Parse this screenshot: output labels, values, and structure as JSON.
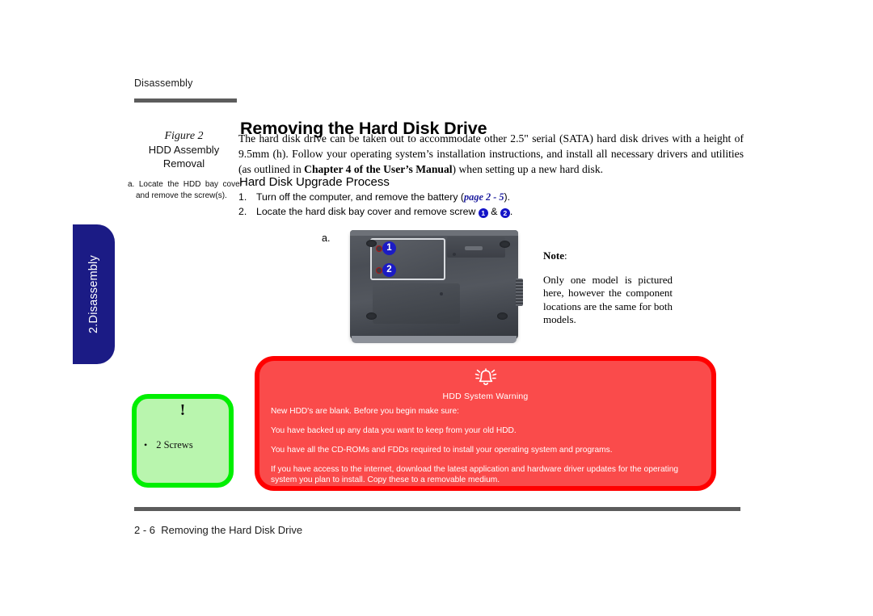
{
  "header": {
    "running_head": "Disassembly"
  },
  "chapter_tab": {
    "label": "2.Disassembly",
    "color": "#1b1b85"
  },
  "figure_caption": {
    "number": "Figure 2",
    "title_line1": "HDD Assembly",
    "title_line2": "Removal"
  },
  "margin_note": {
    "text": "a. Locate the HDD bay cover and remove the screw(s)."
  },
  "main": {
    "title": "Removing the Hard Disk Drive",
    "intro_part1": "The hard disk drive can be taken out to accommodate other 2.5\" serial (SATA) hard disk drives with a height of 9.5mm (h). Follow your operating system’s installation instructions, and install all necessary drivers and utilities (as outlined in ",
    "intro_bold": "Chapter 4 of the User’s Manual",
    "intro_part2": ") when setting up a new hard disk.",
    "subheading": "Hard Disk Upgrade Process",
    "steps": [
      {
        "number": "1.",
        "text_before": "Turn off  the computer, and remove the battery (",
        "page_ref": "page 2 - 5",
        "text_after": ")."
      },
      {
        "number": "2.",
        "text_before": "Locate the hard disk bay cover and remove screw ",
        "marker_a": "1",
        "text_middle": " & ",
        "marker_b": "2",
        "text_after": "."
      }
    ]
  },
  "figure": {
    "letter": "a.",
    "marker_1": "1",
    "marker_2": "2"
  },
  "note": {
    "label": "Note",
    "colon": ":",
    "body": "Only one model is pictured here, however the component locations are the same for both models."
  },
  "tip_box": {
    "bang": "!",
    "bullet": "•",
    "item": "2 Screws",
    "border_color": "#00ef00",
    "fill_color": "#b9f5ae"
  },
  "warning_box": {
    "icon": "bell-warning-icon",
    "title": "HDD System Warning",
    "lines": [
      "New HDD's are blank. Before you begin make sure:",
      "You have backed up any data you want to keep from your old HDD.",
      "You have all the CD-ROMs and FDDs required to install your operating system and programs.",
      "If you have access to the internet, download the latest application and hardware driver updates for the operating system you plan to install. Copy these to a removable medium."
    ],
    "border_color": "#ff0000",
    "fill_color": "#fa4b4b"
  },
  "footer": {
    "page_number": "2  -  6",
    "section": "Removing the Hard Disk Drive"
  }
}
